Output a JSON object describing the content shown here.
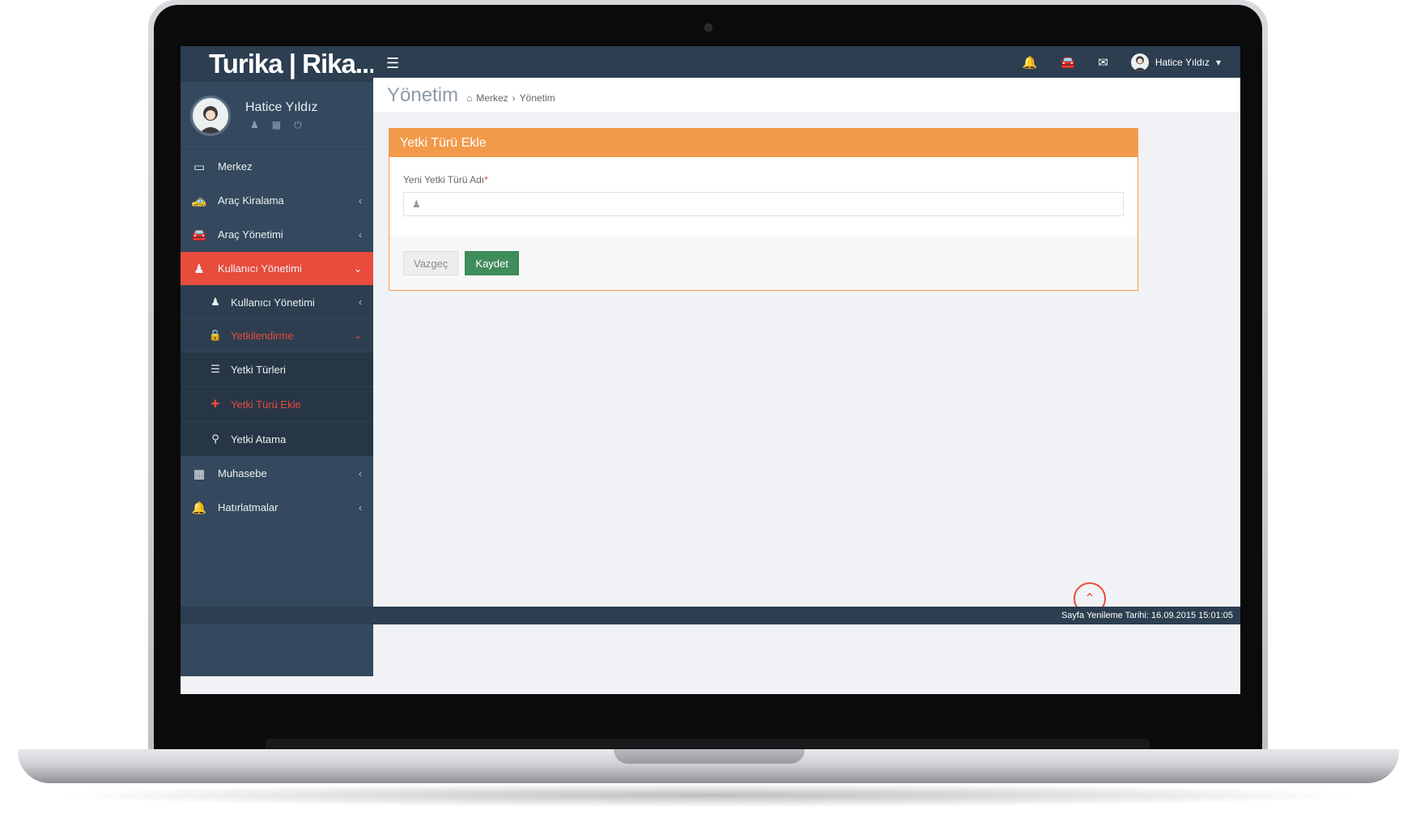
{
  "brand": {
    "name": "Turika | Rika..."
  },
  "profile": {
    "name": "Hatice Yıldız"
  },
  "sidebar": {
    "items": [
      {
        "label": "Merkez",
        "icon": "monitor-icon"
      },
      {
        "label": "Araç Kiralama",
        "icon": "taxi-icon"
      },
      {
        "label": "Araç Yönetimi",
        "icon": "car-icon"
      },
      {
        "label": "Kullanıcı Yönetimi",
        "icon": "users-icon"
      },
      {
        "label": "Muhasebe",
        "icon": "calculator-icon"
      },
      {
        "label": "Hatırlatmalar",
        "icon": "bell-icon"
      }
    ],
    "sub_items": [
      {
        "label": "Kullanıcı Yönetimi",
        "icon": "user-icon"
      },
      {
        "label": "Yetkilendirme",
        "icon": "lock-icon"
      }
    ],
    "subsub_items": [
      {
        "label": "Yetki Türleri",
        "icon": "list-icon"
      },
      {
        "label": "Yetki Türü Ekle",
        "icon": "plus-icon"
      },
      {
        "label": "Yetki Atama",
        "icon": "key-icon"
      }
    ]
  },
  "topbar": {
    "user_name": "Hatice Yıldız"
  },
  "page": {
    "title": "Yönetim",
    "breadcrumb": [
      "Merkez",
      "Yönetim"
    ]
  },
  "panel": {
    "title": "Yetki Türü Ekle",
    "field_label": "Yeni Yetki Türü Adı",
    "required_mark": "*",
    "field_value": "",
    "cancel_label": "Vazgeç",
    "save_label": "Kaydet"
  },
  "status": {
    "text": "Sayfa Yenileme Tarihi: 16.09.2015 15:01:05"
  },
  "colors": {
    "accent": "#e74c3c",
    "panel_header": "#f2994a",
    "sidebar": "#34495e",
    "topbar": "#2c3e50",
    "save": "#3f8d5b"
  }
}
